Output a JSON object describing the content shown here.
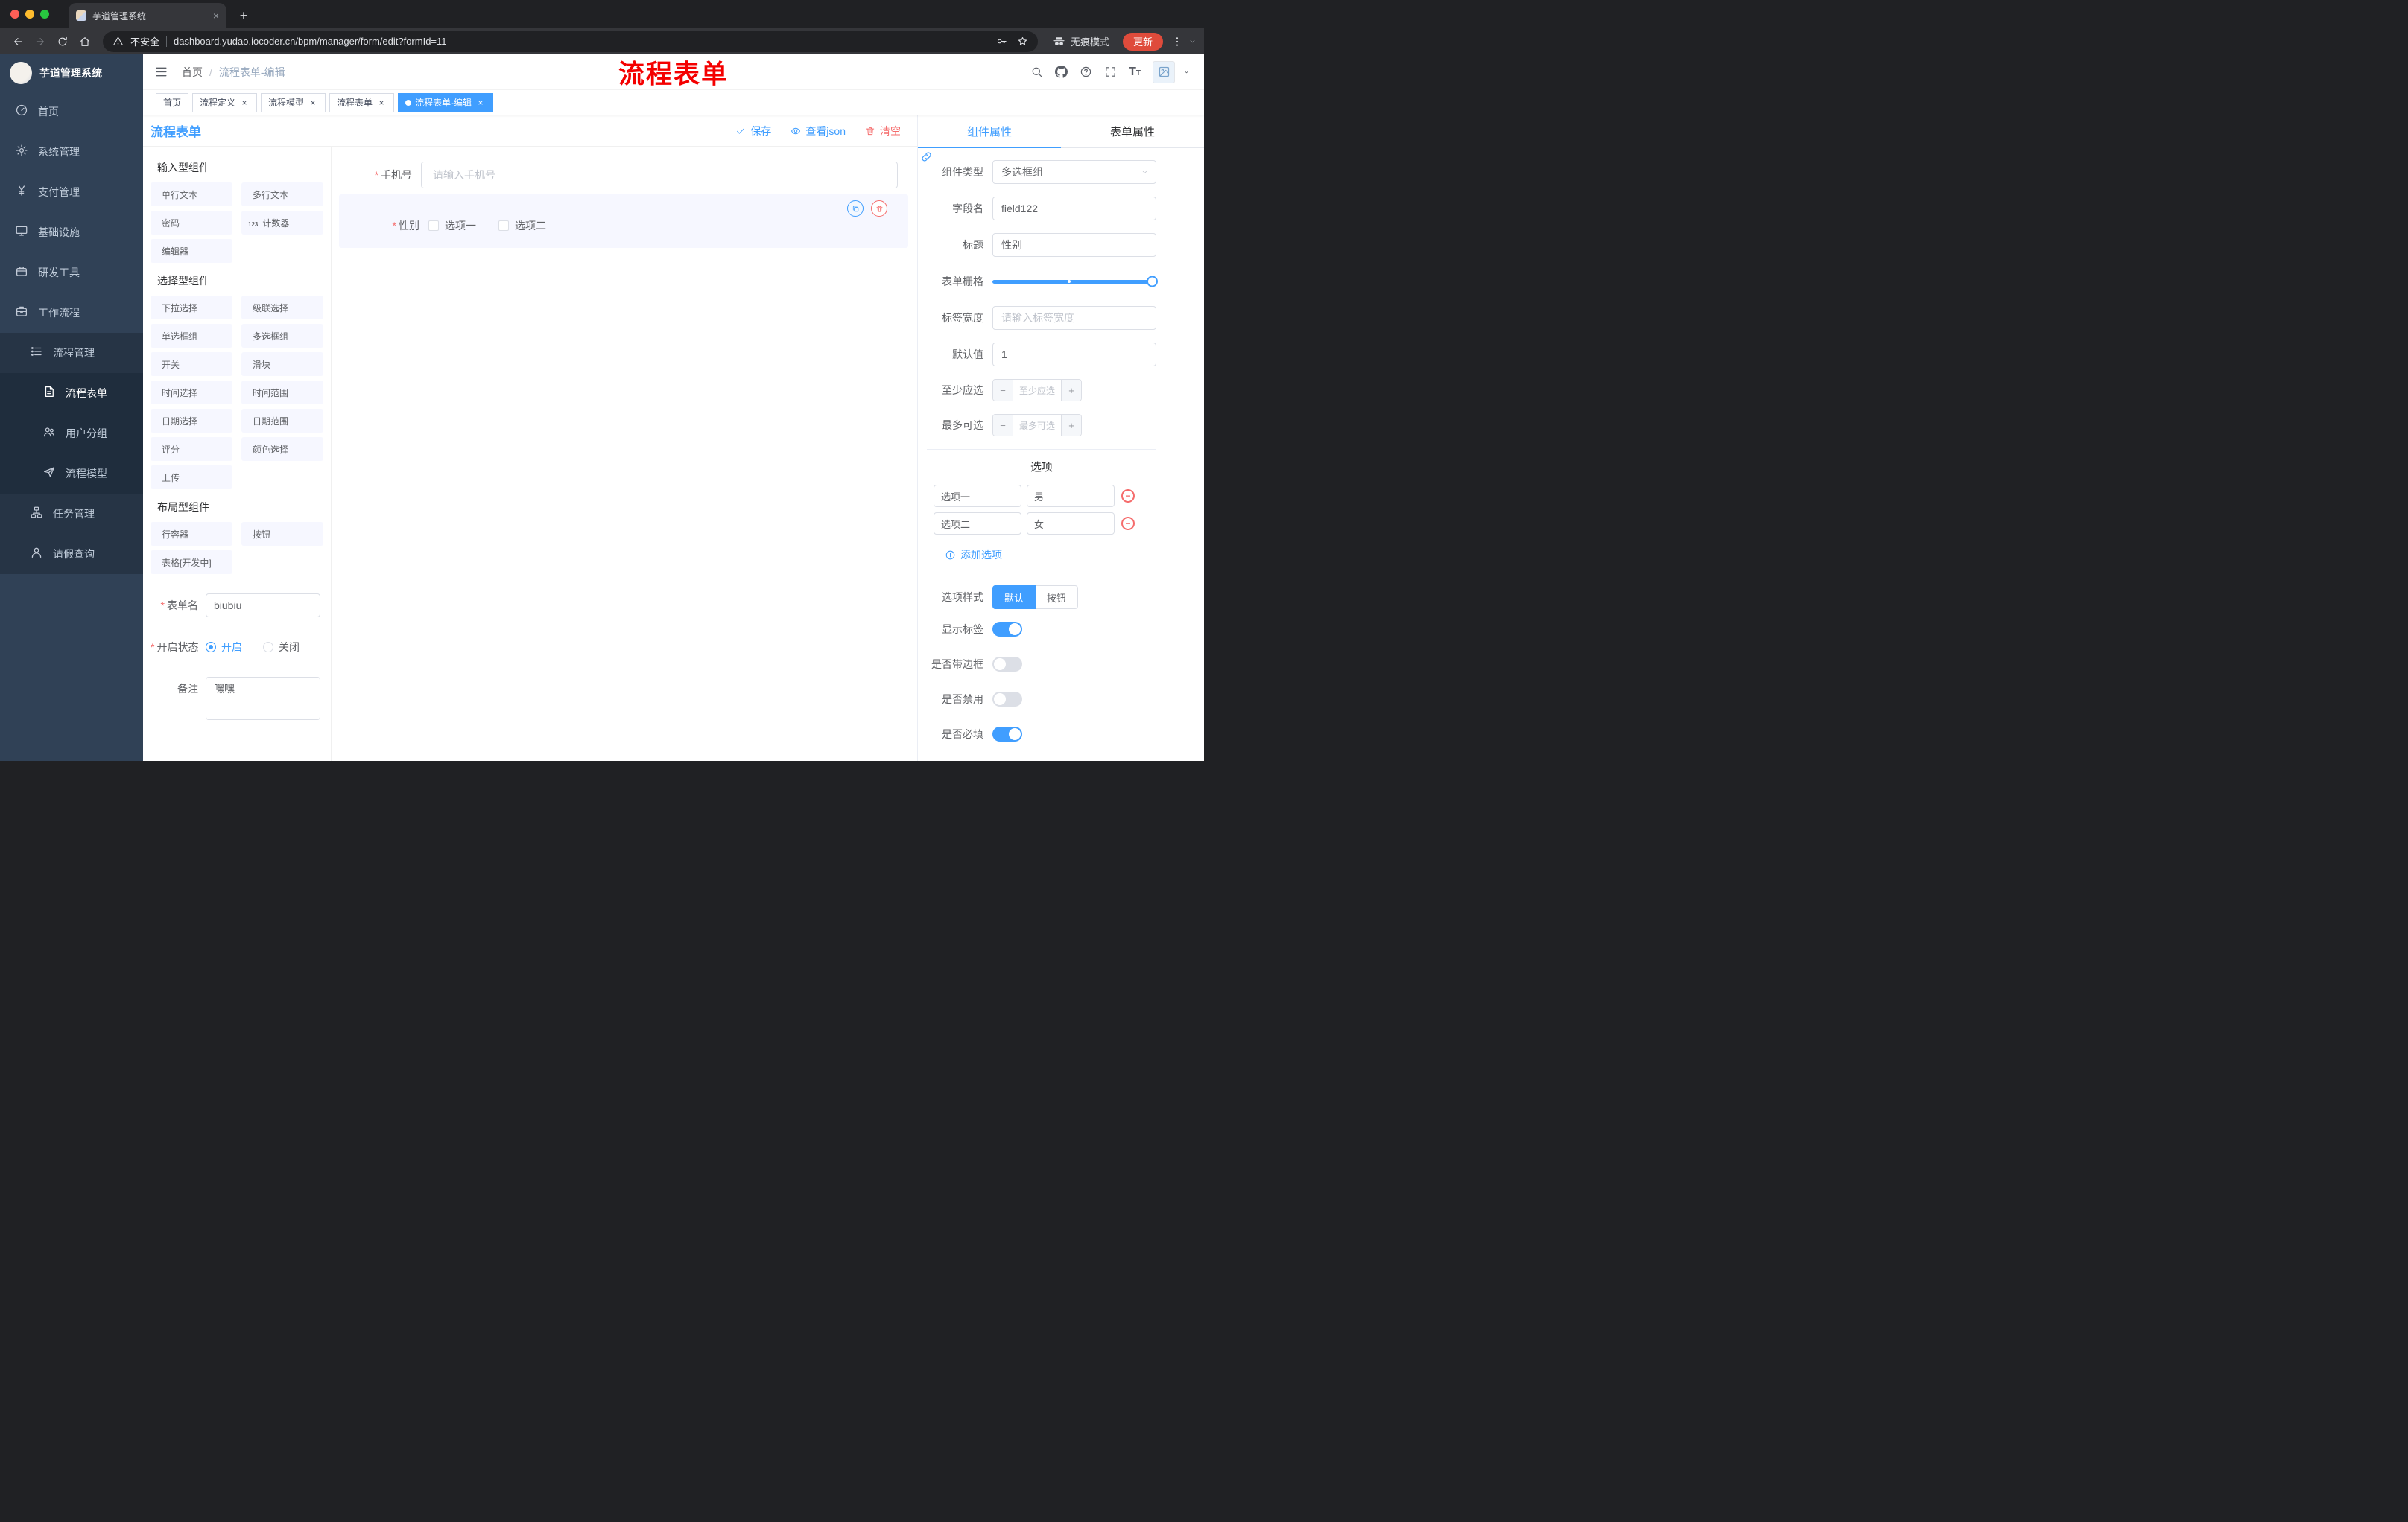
{
  "browser": {
    "tab_title": "芋道管理系统",
    "new_tab": "+",
    "security_label": "不安全",
    "url": "dashboard.yudao.iocoder.cn/bpm/manager/form/edit?formId=11",
    "incognito_label": "无痕模式",
    "update_label": "更新"
  },
  "annotation": {
    "text": "流程表单",
    "color": "#ff0000"
  },
  "sidebar": {
    "logo_title": "芋道管理系统",
    "items": [
      {
        "label": "首页",
        "icon": "dashboard-icon",
        "depth": 0
      },
      {
        "label": "系统管理",
        "icon": "gear-icon",
        "depth": 0,
        "chevron": "down"
      },
      {
        "label": "支付管理",
        "icon": "yen-icon",
        "depth": 0,
        "chevron": "down"
      },
      {
        "label": "基础设施",
        "icon": "monitor-icon",
        "depth": 0,
        "chevron": "down"
      },
      {
        "label": "研发工具",
        "icon": "tools-icon",
        "depth": 0,
        "chevron": "down"
      },
      {
        "label": "工作流程",
        "icon": "briefcase-icon",
        "depth": 0,
        "chevron": "up"
      },
      {
        "label": "流程管理",
        "icon": "list-icon",
        "depth": 1,
        "chevron": "up"
      },
      {
        "label": "流程表单",
        "icon": "document-icon",
        "depth": 2,
        "active": true
      },
      {
        "label": "用户分组",
        "icon": "users-icon",
        "depth": 2
      },
      {
        "label": "流程模型",
        "icon": "send-icon",
        "depth": 2
      },
      {
        "label": "任务管理",
        "icon": "workflow-icon",
        "depth": 1,
        "chevron": "down"
      },
      {
        "label": "请假查询",
        "icon": "user-icon",
        "depth": 1
      }
    ]
  },
  "header": {
    "breadcrumb": [
      "首页",
      "流程表单-编辑"
    ]
  },
  "tags": [
    {
      "label": "首页",
      "active": false,
      "closable": false
    },
    {
      "label": "流程定义",
      "active": false,
      "closable": true
    },
    {
      "label": "流程模型",
      "active": false,
      "closable": true
    },
    {
      "label": "流程表单",
      "active": false,
      "closable": true
    },
    {
      "label": "流程表单-编辑",
      "active": true,
      "closable": true
    }
  ],
  "designer": {
    "title": "流程表单",
    "actions": {
      "save": "保存",
      "view_json": "查看json",
      "clear": "清空"
    },
    "palette": [
      {
        "title": "输入型组件",
        "chips": [
          {
            "label": "单行文本",
            "icon": "input-icon"
          },
          {
            "label": "多行文本",
            "icon": "textarea-icon"
          },
          {
            "label": "密码",
            "icon": "lock-icon"
          },
          {
            "label": "计数器",
            "icon": "counter-icon"
          },
          {
            "label": "编辑器",
            "icon": "editor-icon"
          }
        ]
      },
      {
        "title": "选择型组件",
        "chips": [
          {
            "label": "下拉选择",
            "icon": "select-icon"
          },
          {
            "label": "级联选择",
            "icon": "cascader-icon"
          },
          {
            "label": "单选框组",
            "icon": "radio-icon"
          },
          {
            "label": "多选框组",
            "icon": "checkbox-icon"
          },
          {
            "label": "开关",
            "icon": "switch-icon"
          },
          {
            "label": "滑块",
            "icon": "slider-icon"
          },
          {
            "label": "时间选择",
            "icon": "time-icon"
          },
          {
            "label": "时间范围",
            "icon": "time-range-icon"
          },
          {
            "label": "日期选择",
            "icon": "date-icon"
          },
          {
            "label": "日期范围",
            "icon": "date-range-icon"
          },
          {
            "label": "评分",
            "icon": "rate-icon"
          },
          {
            "label": "颜色选择",
            "icon": "color-icon"
          },
          {
            "label": "上传",
            "icon": "upload-icon"
          }
        ]
      },
      {
        "title": "布局型组件",
        "chips": [
          {
            "label": "行容器",
            "icon": "row-icon"
          },
          {
            "label": "按钮",
            "icon": "button-icon"
          },
          {
            "label": "表格[开发中]",
            "icon": "table-icon"
          }
        ]
      }
    ],
    "meta": {
      "form_name": {
        "label": "表单名",
        "required": true,
        "value": "biubiu"
      },
      "status": {
        "label": "开启状态",
        "required": true,
        "options": [
          "开启",
          "关闭"
        ],
        "selected": "开启"
      },
      "remark": {
        "label": "备注",
        "value": "嘿嘿"
      }
    },
    "canvas": {
      "phone": {
        "label": "手机号",
        "required": true,
        "placeholder": "请输入手机号"
      },
      "gender": {
        "label": "性别",
        "required": true,
        "options": [
          "选项一",
          "选项二"
        ],
        "checked": []
      }
    }
  },
  "properties": {
    "tabs": [
      "组件属性",
      "表单属性"
    ],
    "active_tab": "组件属性",
    "component_type": {
      "label": "组件类型",
      "value": "多选框组"
    },
    "field_name": {
      "label": "字段名",
      "value": "field122"
    },
    "title": {
      "label": "标题",
      "value": "性别"
    },
    "grid": {
      "label": "表单栅格",
      "value": 24,
      "max": 24
    },
    "label_width": {
      "label": "标签宽度",
      "placeholder": "请输入标签宽度"
    },
    "default_value": {
      "label": "默认值",
      "value": "1"
    },
    "min_select": {
      "label": "至少应选",
      "placeholder": "至少应选"
    },
    "max_select": {
      "label": "最多可选",
      "placeholder": "最多可选"
    },
    "options_section": {
      "title": "选项",
      "rows": [
        {
          "name": "选项一",
          "value": "男"
        },
        {
          "name": "选项二",
          "value": "女"
        }
      ],
      "add_label": "添加选项"
    },
    "option_style": {
      "label": "选项样式",
      "choices": [
        "默认",
        "按钮"
      ],
      "selected": "默认"
    },
    "toggles": [
      {
        "label": "显示标签",
        "on": true
      },
      {
        "label": "是否带边框",
        "on": false
      },
      {
        "label": "是否禁用",
        "on": false
      },
      {
        "label": "是否必填",
        "on": true
      }
    ]
  },
  "colors": {
    "accent": "#409eff",
    "danger": "#f56c6c",
    "annotation_red": "#ff0000",
    "sidebar_bg": "#304156",
    "sidebar_submenu_bg": "#1f2d3d",
    "chrome_bg": "#202124",
    "chrome_toolbar_bg": "#35363a",
    "update_button_bg": "#df4b3b",
    "active_tag_bg": "#409eff",
    "selected_component_bg": "#f6f7ff"
  },
  "icons": {
    "search-icon": "magnifier",
    "github-icon": "octocat",
    "help-icon": "question-circle",
    "fullscreen-icon": "expand-corners",
    "font-size-icon": "TT",
    "hamburger-icon": "menu-lines",
    "back-icon": "arrow-left",
    "forward-icon": "arrow-right",
    "reload-icon": "circular-arrow",
    "home-icon": "house",
    "warning-icon": "triangle-exclamation",
    "key-icon": "key",
    "star-icon": "star",
    "incognito-icon": "spy-glasses",
    "menu-dots-icon": "vertical-dots",
    "check-icon": "checkmark",
    "eye-icon": "eye",
    "trash-icon": "trash-can",
    "copy-icon": "double-square",
    "link-icon": "chain-link",
    "drag-icon": "sliders",
    "add-icon": "circle-plus",
    "chevron-down-icon": "caret-down",
    "image-icon": "picture-placeholder",
    "component-icon": "cube"
  }
}
